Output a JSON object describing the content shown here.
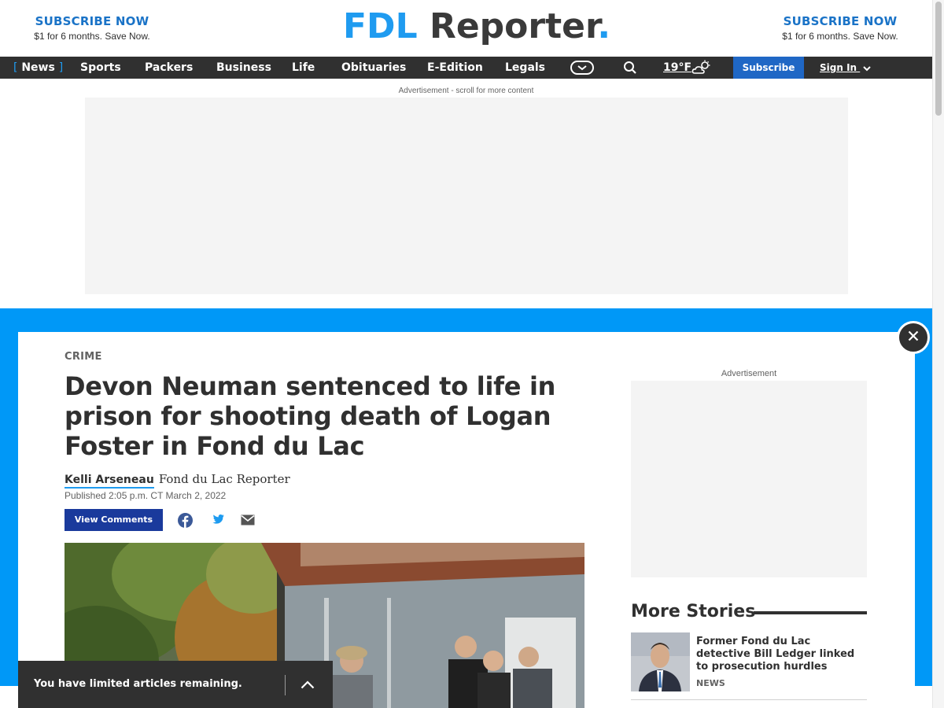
{
  "promo_left": {
    "title": "SUBSCRIBE NOW",
    "subtitle": "$1 for 6 months. Save Now."
  },
  "promo_right": {
    "title": "SUBSCRIBE NOW",
    "subtitle": "$1 for 6 months. Save Now."
  },
  "logo": {
    "part1": "FDL",
    "part2": " Reporter",
    "dot": ".",
    "accent_color": "#1f9bf0"
  },
  "nav": {
    "items": [
      {
        "label": "News",
        "active": true
      },
      {
        "label": "Sports"
      },
      {
        "label": "Packers"
      },
      {
        "label": "Business"
      },
      {
        "label": "Life"
      },
      {
        "label": "Obituaries"
      },
      {
        "label": "E-Edition"
      },
      {
        "label": "Legals"
      }
    ],
    "bracket_open": "[",
    "bracket_close": "]",
    "more_icon": "chevron-circle-icon",
    "search_icon": "search-icon",
    "weather_temp": "19°F",
    "weather_icon": "partly-cloudy-icon",
    "subscribe_label": "Subscribe",
    "signin_label": "Sign In",
    "subscribe_color": "#1f67c5"
  },
  "ad_top": {
    "label": "Advertisement - scroll for more content"
  },
  "article": {
    "kicker": "CRIME",
    "headline": "Devon Neuman sentenced to life in prison for shooting death of Logan Foster in Fond du Lac",
    "author": "Kelli Arseneau",
    "publication": "Fond du Lac Reporter",
    "published": "Published 2:05 p.m. CT March 2, 2022",
    "comments_label": "View Comments",
    "share_icons": [
      "facebook-icon",
      "twitter-icon",
      "email-icon"
    ]
  },
  "right_rail": {
    "ad_label": "Advertisement",
    "more_stories_title": "More Stories",
    "stories": [
      {
        "headline": "Former Fond du Lac detective Bill Ledger linked to prosecution hurdles",
        "label": "NEWS"
      }
    ]
  },
  "limit_bar": {
    "text": "You have limited articles remaining."
  },
  "colors": {
    "band": "#0098f7",
    "nav_bg": "#303030",
    "comments_btn": "#1a3a9c"
  }
}
